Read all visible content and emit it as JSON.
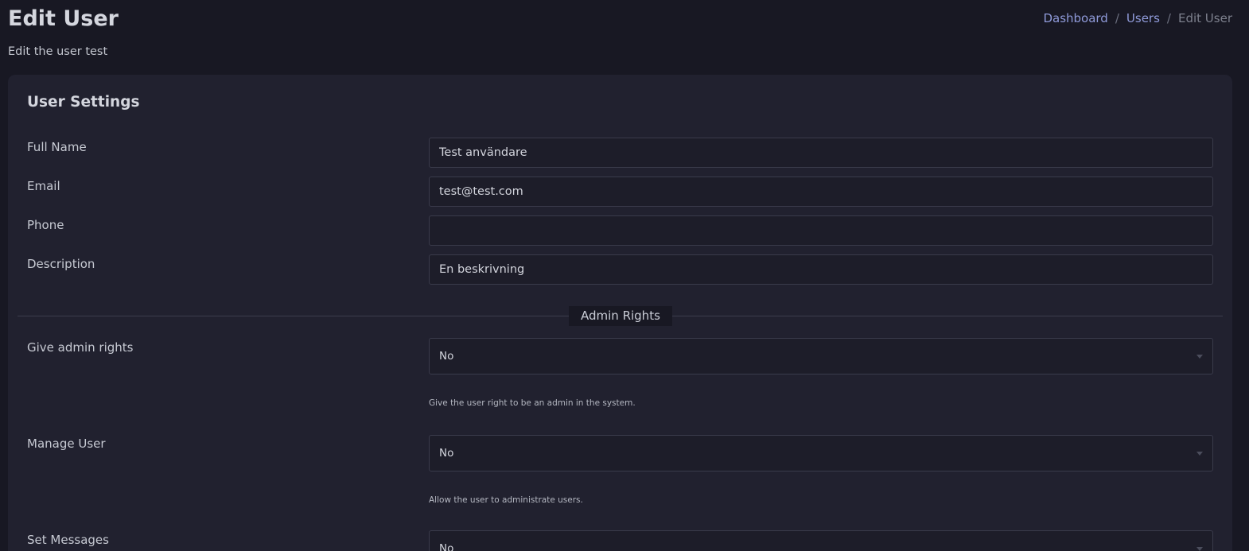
{
  "header": {
    "title": "Edit User",
    "subtitle": "Edit the user test"
  },
  "breadcrumb": {
    "items": [
      {
        "label": "Dashboard"
      },
      {
        "label": "Users"
      },
      {
        "label": "Edit User"
      }
    ],
    "separator": "/"
  },
  "card": {
    "title": "User Settings",
    "fields": {
      "full_name": {
        "label": "Full Name",
        "value": "Test användare"
      },
      "email": {
        "label": "Email",
        "value": "test@test.com"
      },
      "phone": {
        "label": "Phone",
        "value": ""
      },
      "description": {
        "label": "Description",
        "value": "En beskrivning"
      }
    },
    "admin_section": {
      "heading": "Admin Rights",
      "give_admin": {
        "label": "Give admin rights",
        "value": "No",
        "help": "Give the user right to be an admin in the system."
      },
      "manage_user": {
        "label": "Manage User",
        "value": "No",
        "help": "Allow the user to administrate users."
      },
      "set_messages": {
        "label": "Set Messages",
        "value": "No"
      }
    }
  },
  "colors": {
    "background": "#181823",
    "card": "#21212f",
    "link": "#8f9ad9"
  },
  "icons": {
    "select_caret": "chevron-down-icon"
  }
}
